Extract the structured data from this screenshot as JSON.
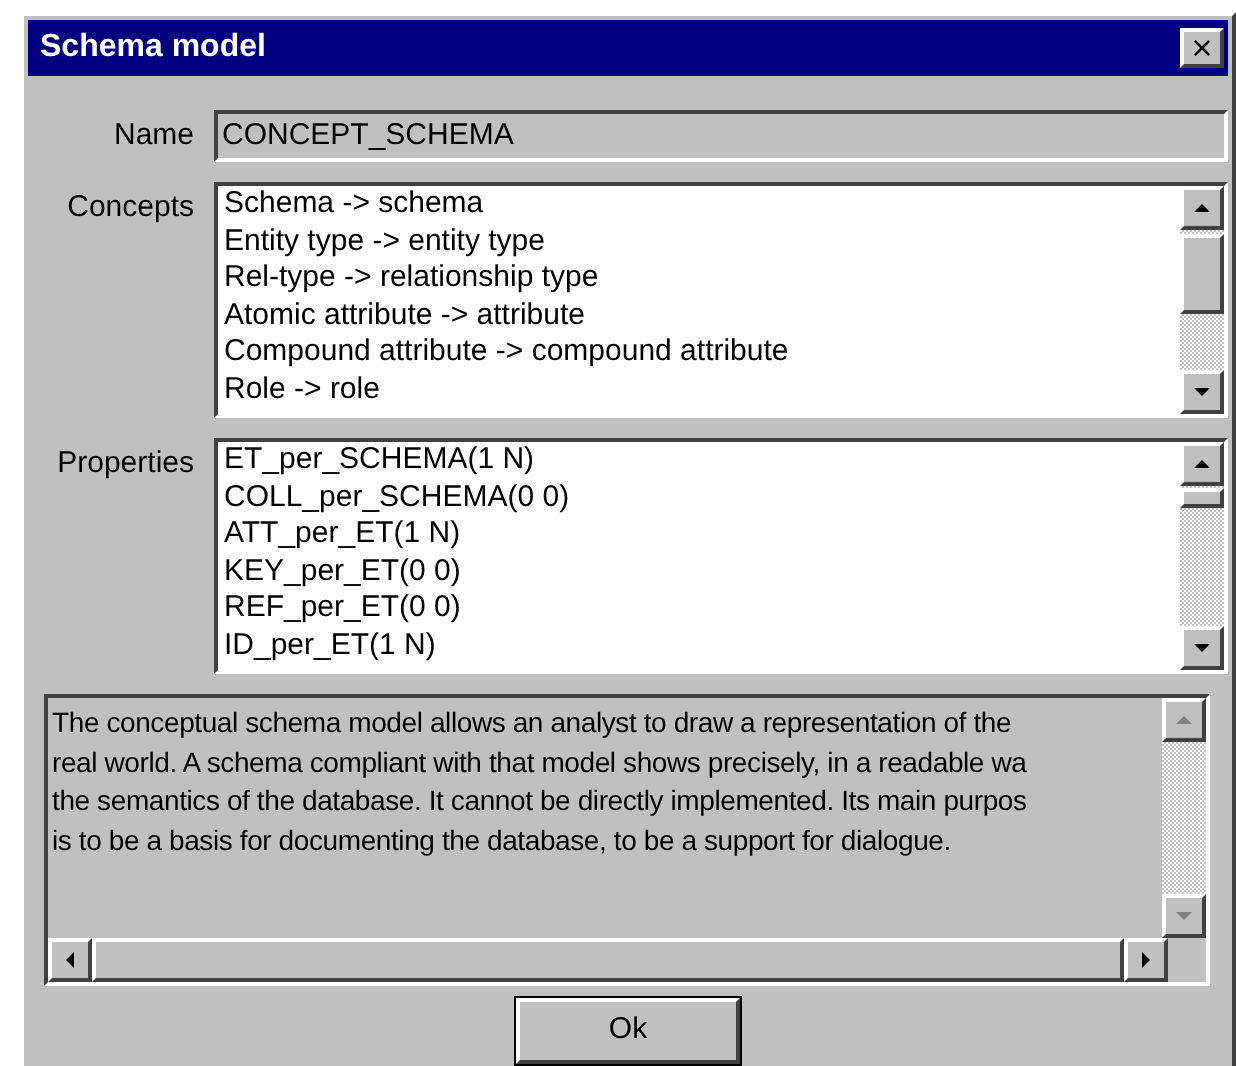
{
  "window": {
    "title": "Schema model",
    "close": "×"
  },
  "name_field": {
    "label": "Name",
    "value": "CONCEPT_SCHEMA"
  },
  "concepts": {
    "label": "Concepts",
    "items": [
      "Schema -> schema",
      "Entity type -> entity type",
      "Rel-type -> relationship type",
      "Atomic attribute -> attribute",
      "Compound attribute -> compound attribute",
      "Role -> role"
    ]
  },
  "properties": {
    "label": "Properties",
    "items": [
      "ET_per_SCHEMA(1 N)",
      "COLL_per_SCHEMA(0 0)",
      "ATT_per_ET(1 N)",
      "KEY_per_ET(0 0)",
      "REF_per_ET(0 0)",
      "ID_per_ET(1 N)"
    ]
  },
  "description": {
    "lines": [
      "The conceptual schema model allows an analyst to draw a representation of the",
      "real world. A schema compliant with that model shows precisely, in a readable wa",
      "the semantics of the database. It cannot be directly implemented. Its main purpos",
      "is to be a basis for documenting the database, to be a support for dialogue."
    ]
  },
  "buttons": [
    "Ok"
  ]
}
